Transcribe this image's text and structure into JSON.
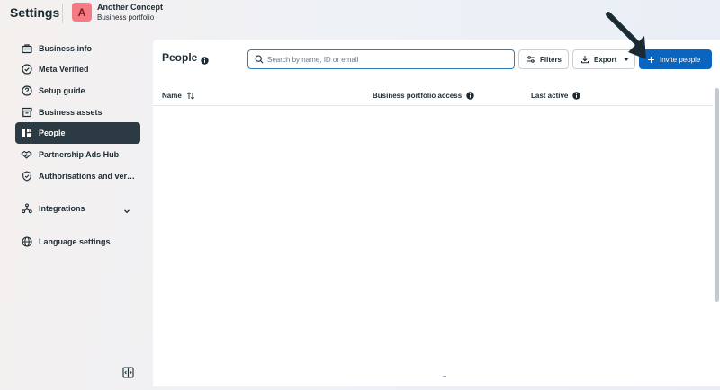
{
  "header": {
    "title": "Settings",
    "avatar_letter": "A",
    "account_name": "Another Concept",
    "account_subtitle": "Business portfolio"
  },
  "sidebar": {
    "items": [
      {
        "label": "Business info",
        "icon": "briefcase-icon"
      },
      {
        "label": "Meta Verified",
        "icon": "verified-badge-icon"
      },
      {
        "label": "Setup guide",
        "icon": "question-circle-icon"
      },
      {
        "label": "Business assets",
        "icon": "archive-box-icon"
      },
      {
        "label": "People",
        "icon": "people-icon",
        "active": true
      },
      {
        "label": "Partnership Ads Hub",
        "icon": "handshake-icon"
      },
      {
        "label": "Authorisations and veri...",
        "icon": "shield-check-icon"
      },
      {
        "label": "Integrations",
        "icon": "integrations-icon",
        "expandable": true
      },
      {
        "label": "Language settings",
        "icon": "globe-icon"
      }
    ]
  },
  "main": {
    "title": "People",
    "search_placeholder": "Search by name, ID or email",
    "filters_label": "Filters",
    "export_label": "Export",
    "invite_label": "Invite people",
    "columns": [
      {
        "label": "Name",
        "extra_icon": "sort-icon"
      },
      {
        "label": "Business portfolio access",
        "extra_icon": "info-icon"
      },
      {
        "label": "Last active",
        "extra_icon": "info-icon"
      }
    ]
  },
  "colors": {
    "accent": "#0b64c0",
    "active_nav": "#2b3a43",
    "avatar_bg": "#f47b84",
    "search_border": "#2d7fb5"
  }
}
